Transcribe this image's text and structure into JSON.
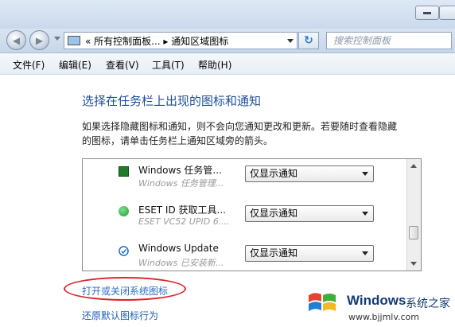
{
  "navigation": {
    "address_path": "« 所有控制面板... ▸ 通知区域图标",
    "search_placeholder": "搜索控制面板"
  },
  "menubar": {
    "items": [
      {
        "label": "文件(F)"
      },
      {
        "label": "编辑(E)"
      },
      {
        "label": "查看(V)"
      },
      {
        "label": "工具(T)"
      },
      {
        "label": "帮助(H)"
      }
    ]
  },
  "main": {
    "heading": "选择在任务栏上出现的图标和通知",
    "description_line1": "如果选择隐藏图标和通知，则不会向您通知更改和更新。若要随时查看隐藏",
    "description_line2": "的图标，请单击任务栏上通知区域旁的箭头。",
    "rows": [
      {
        "icon": "green-square-app-icon",
        "name": "Windows 任务管...",
        "subtitle": "Windows 任务管理...",
        "behavior": "仅显示通知"
      },
      {
        "icon": "eset-green-icon",
        "name": "ESET ID 获取工具...",
        "subtitle": "ESET VC52 UPID 6....",
        "behavior": "仅显示通知"
      },
      {
        "icon": "windows-update-icon",
        "name": "Windows Update",
        "subtitle": "Windows 已安装新...",
        "behavior": "仅显示通知"
      }
    ],
    "system_icons_link": "打开或关闭系统图标",
    "restore_link": "还原默认图标行为"
  },
  "watermark": {
    "brand": "Windows",
    "brand_suffix": "系统之家",
    "url": "www.bjjmlv.com"
  },
  "colors": {
    "heading": "#1e4e9a",
    "link": "#2a6fc4",
    "highlight_oval": "#d7262b"
  }
}
